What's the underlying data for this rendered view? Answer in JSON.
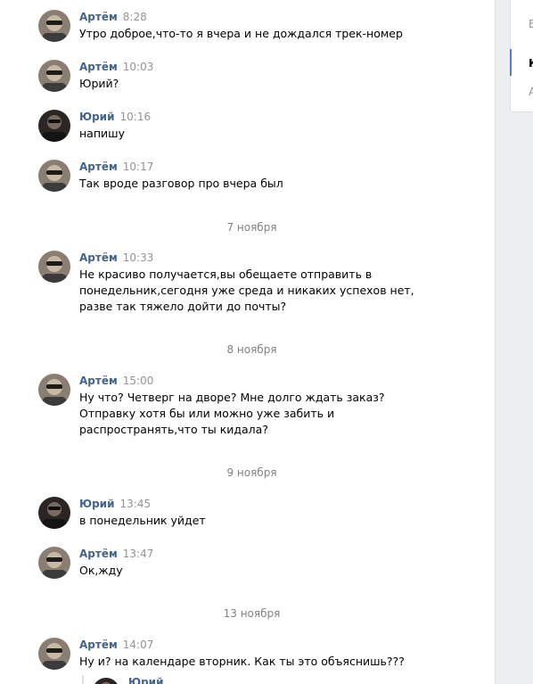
{
  "users": {
    "artem": {
      "name": "Артём"
    },
    "yuri": {
      "name": "Юрий"
    }
  },
  "messages": [
    {
      "author": "Артём",
      "time": "8:28",
      "text": "Утро доброе,что-то я вчера и не дождался трек-номер"
    },
    {
      "author": "Артём",
      "time": "10:03",
      "text": "Юрий?"
    },
    {
      "author": "Юрий",
      "time": "10:16",
      "text": "напишу"
    },
    {
      "author": "Артём",
      "time": "10:17",
      "text": "Так вроде разговор про вчера был"
    },
    {
      "author": "Артём",
      "time": "10:33",
      "text": "Не красиво получается,вы обещаете отправить в понедельник,сегодня уже среда и никаких успехов нет, разве так тяжело дойти до почты?"
    },
    {
      "author": "Артём",
      "time": "15:00",
      "text": "Ну что? Четверг на дворе? Мне долго ждать заказ? Отправку хотя бы или можно уже забить и распространять,что ты кидала?"
    },
    {
      "author": "Юрий",
      "time": "13:45",
      "text": "в понедельник уйдет"
    },
    {
      "author": "Артём",
      "time": "13:47",
      "text": "Ок,жду"
    },
    {
      "author": "Артём",
      "time": "14:07",
      "text": "Ну и? на календаре вторник. Как ты это объяснишь???"
    }
  ],
  "dates": [
    "7 ноября",
    "8 ноября",
    "9 ноября",
    "13 ноября"
  ],
  "forwarded": {
    "author": "Юрий"
  },
  "right_panel": {
    "items": [
      "В",
      "К",
      "А"
    ],
    "active_index": 1
  },
  "colors": {
    "author": "#42648b",
    "time": "#939393",
    "date": "#828282",
    "accent": "#5181b8"
  }
}
